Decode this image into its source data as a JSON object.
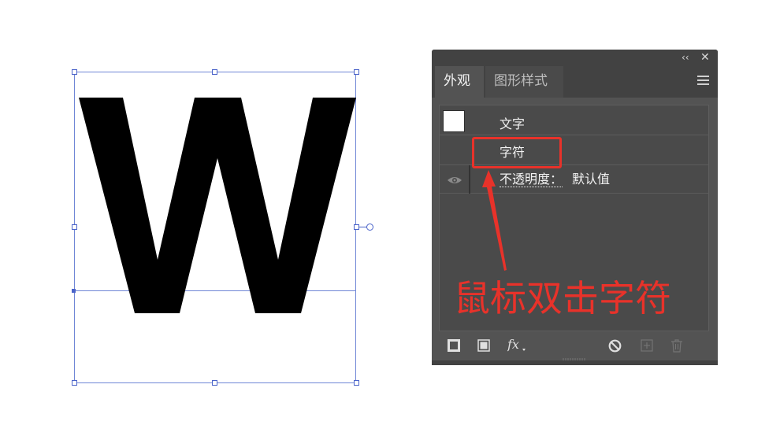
{
  "canvas": {
    "glyph": "W",
    "glyph_color": "#000000",
    "selection_color": "#4a63c9"
  },
  "panel": {
    "tabs": [
      {
        "label": "外观",
        "active": true
      },
      {
        "label": "图形样式",
        "active": false
      }
    ],
    "icons": {
      "collapse": "double-chevron-left-icon",
      "close": "close-icon",
      "menu": "hamburger-menu-icon"
    },
    "rows": {
      "object_label": "文字",
      "character_label": "字符",
      "opacity_label": "不透明度：",
      "opacity_value": "默认值"
    },
    "bottom_toolbar": [
      "add-new-stroke-icon",
      "add-new-fill-icon",
      "add-new-effect-fx-icon",
      "clear-appearance-icon",
      "duplicate-item-icon",
      "delete-item-icon"
    ]
  },
  "annotation": {
    "text": "鼠标双击字符",
    "color": "#e8322a"
  }
}
